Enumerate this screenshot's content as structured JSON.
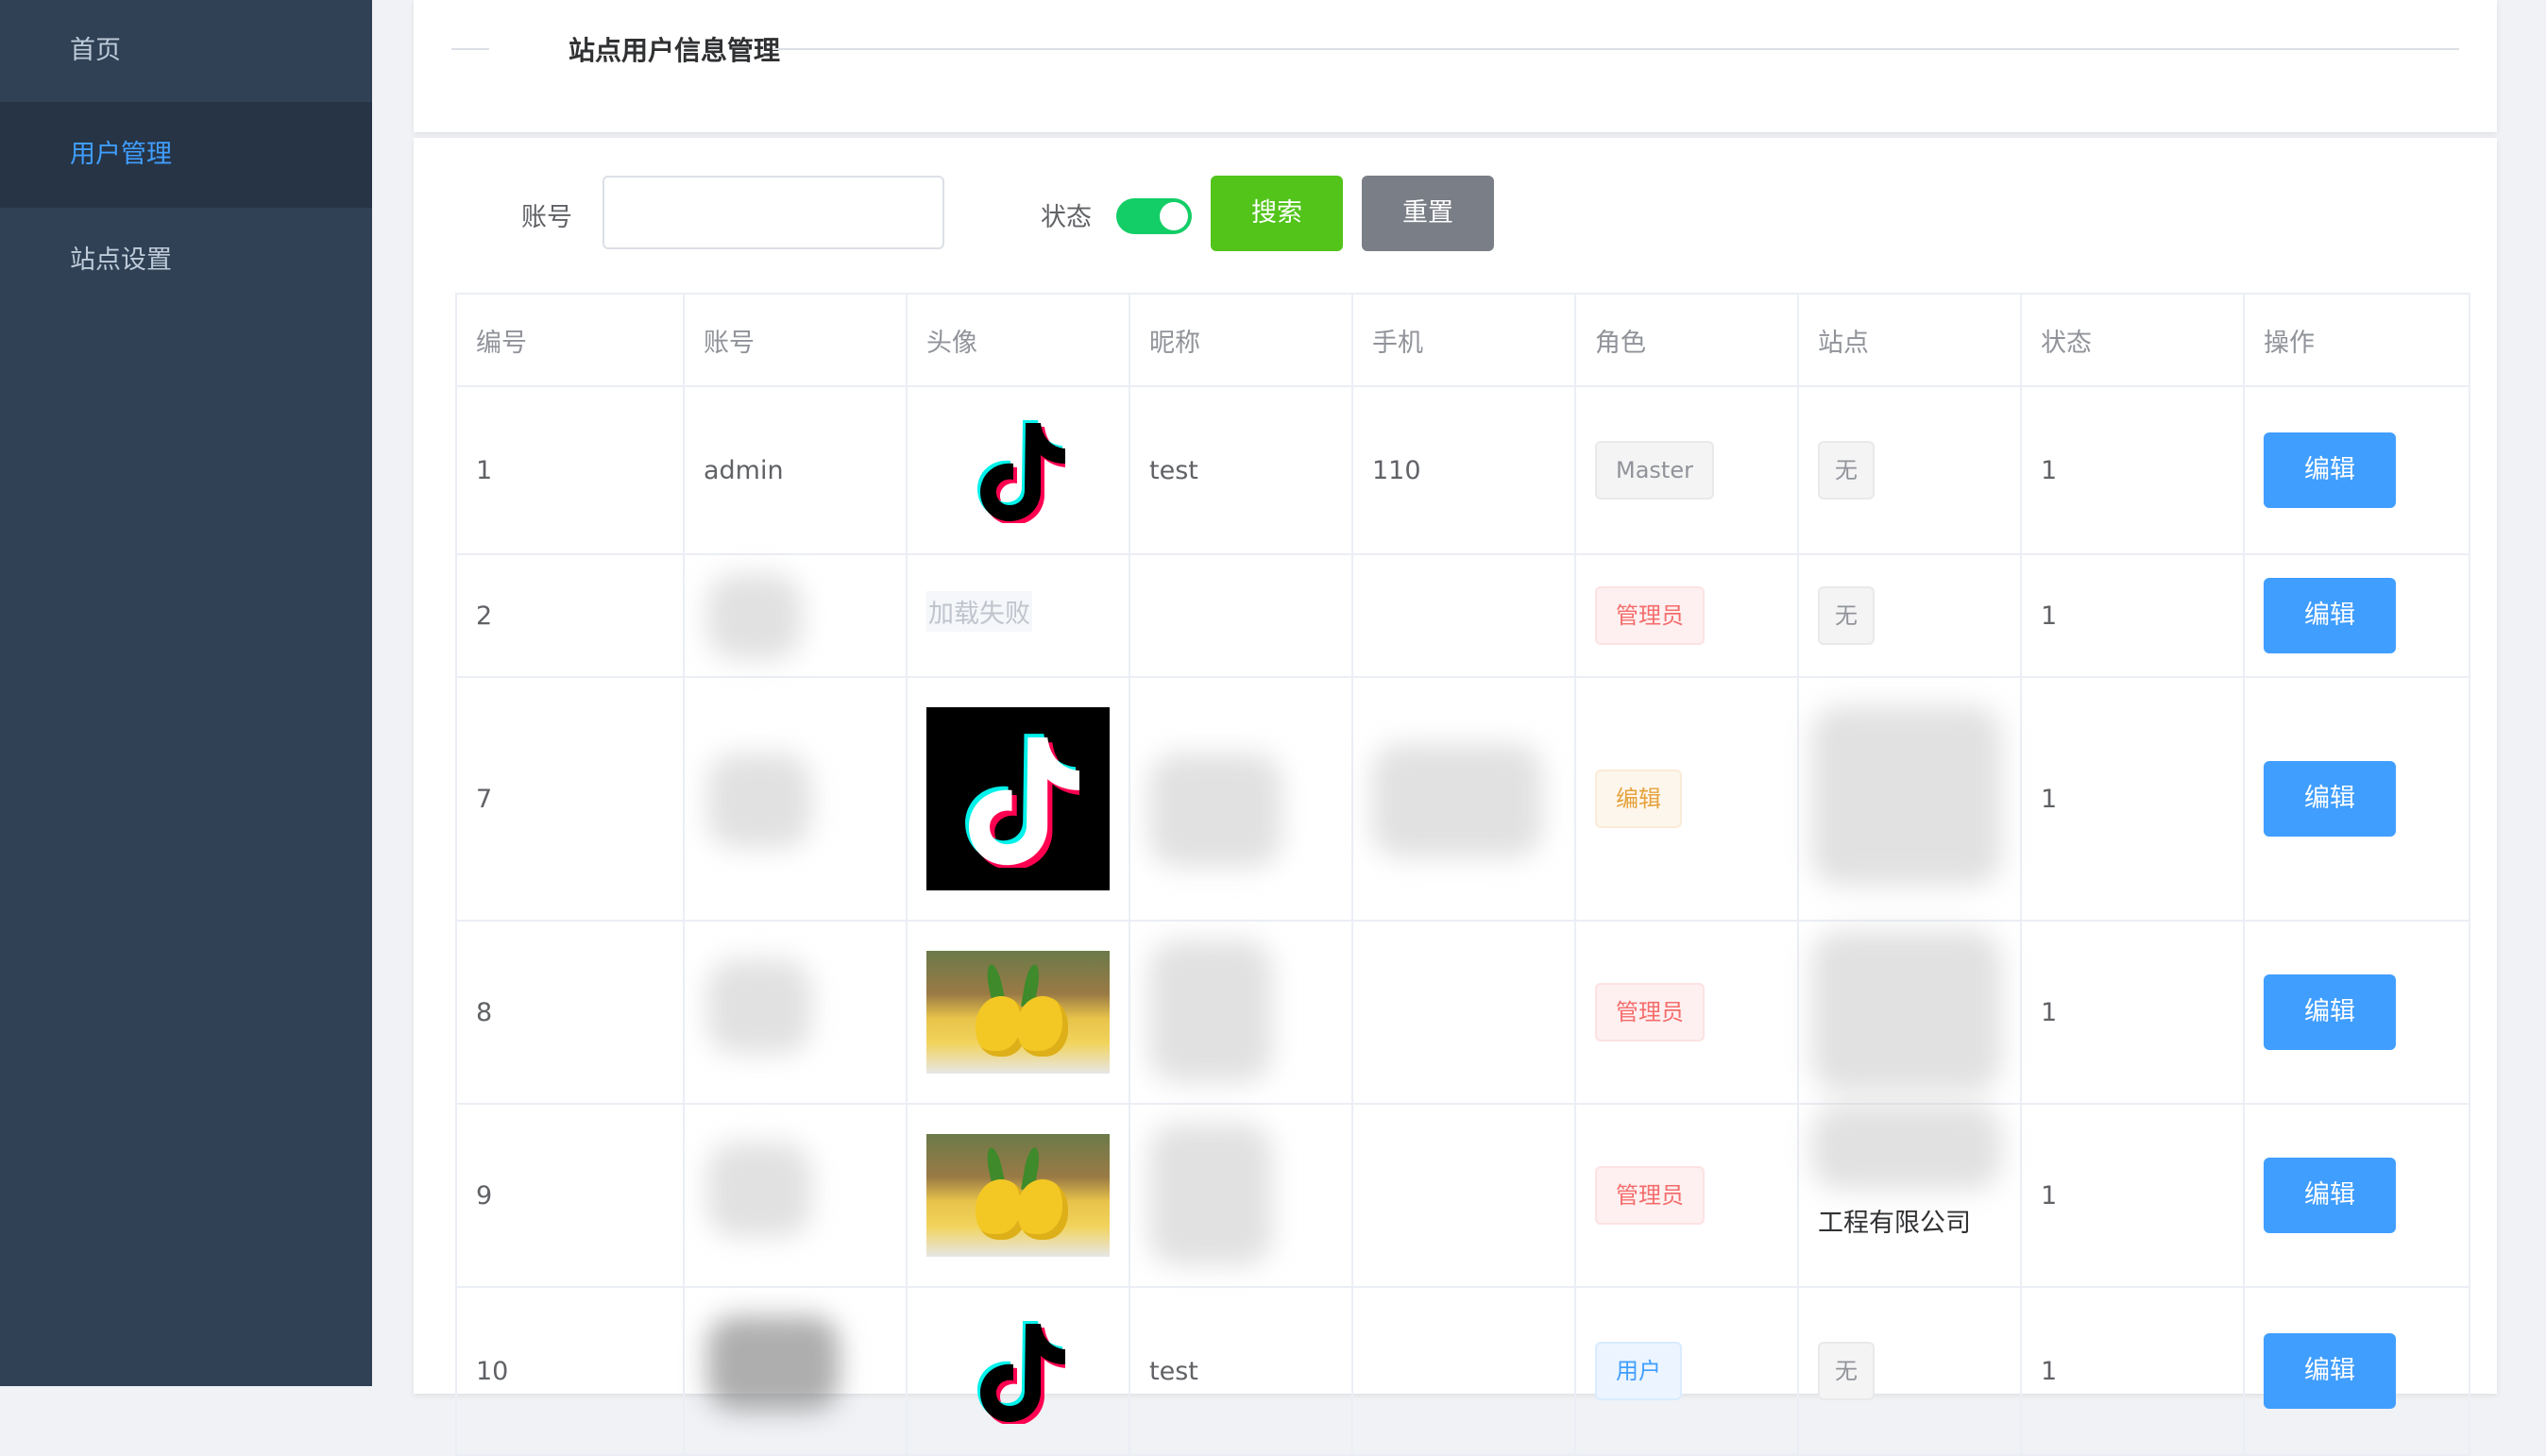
{
  "sidebar": {
    "items": [
      {
        "label": "首页"
      },
      {
        "label": "用户管理"
      },
      {
        "label": "站点设置"
      }
    ]
  },
  "header": {
    "title": "站点用户信息管理"
  },
  "search": {
    "account_label": "账号",
    "account_value": "",
    "status_label": "状态",
    "status_on": true,
    "search_label": "搜索",
    "reset_label": "重置"
  },
  "table": {
    "columns": [
      "编号",
      "账号",
      "头像",
      "昵称",
      "手机",
      "角色",
      "站点",
      "状态",
      "操作"
    ],
    "rows": [
      {
        "id": "1",
        "account": "admin",
        "avatar": "tiktok-logo",
        "nickname": "test",
        "phone": "110",
        "role": "Master",
        "site": "无",
        "status": "1",
        "action": "编辑"
      },
      {
        "id": "2",
        "account": "",
        "avatar": "加载失败",
        "nickname": "",
        "phone": "",
        "role": "管理员",
        "site": "无",
        "status": "1",
        "action": "编辑"
      },
      {
        "id": "7",
        "account": "",
        "avatar": "tiktok-logo-black",
        "nickname": "",
        "phone": "",
        "role": "编辑",
        "site": "",
        "status": "1",
        "action": "编辑"
      },
      {
        "id": "8",
        "account": "",
        "avatar": "pineapple-photo",
        "nickname": "",
        "phone": "",
        "role": "管理员",
        "site": "",
        "status": "1",
        "action": "编辑"
      },
      {
        "id": "9",
        "account": "",
        "avatar": "pineapple-photo",
        "nickname": "",
        "phone": "",
        "role": "管理员",
        "site": "工程有限公司",
        "status": "1",
        "action": "编辑"
      },
      {
        "id": "10",
        "account": "",
        "avatar": "tiktok-logo",
        "nickname": "test",
        "phone": "",
        "role": "用户",
        "site": "无",
        "status": "1",
        "action": "编辑"
      }
    ]
  },
  "colors": {
    "sidebar_bg": "#304156",
    "sidebar_active": "#409eff",
    "primary": "#409eff",
    "search_btn": "#52c41a",
    "reset_btn": "#7a7e86",
    "switch_on": "#13ce66"
  }
}
